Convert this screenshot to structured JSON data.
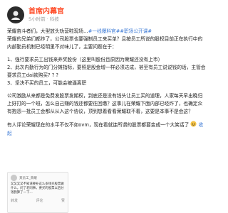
{
  "header": {
    "username": "首席内幕官",
    "sublabel": "5小时前 · 科技"
  },
  "post": {
    "intro": "荣耀奋斗者们，大型放头劝营啦现场…",
    "tag1": "#一线爆料官#",
    "tag2": "#职场公开课#",
    "sentences": [
      "荣耀的兄弟们都炸了，公司股票也要强制员工来买单？且按员工所说的股权目前正在执行中的内部勤员机制已经明里不对味儿了，主要问题在于：",
      "1、强行要求员工出钱来养奖股份（这里叫股份且原因为荣耀还没有上市）",
      "2、此次内勤行为的门分摊指标，要照是股金增一样必须达成，甚至有员工说说钱的话，主管会要求员工dai款购买? ? ?",
      "3、坚决不买的员工，可能会被逼离职",
      "公司激励从来都是免费发股票发期权，到底还是没有钱头让员工买的道理，人家每天早出晚归上好打的一个班，怎么自己赚的钱还都要往回缴？这事儿在荣耀下面内部已经炸了，也确定众有抱怨一批员工会都从从入这个协议，顶到想着看看荣耀取不着，这要是本事不是会这？",
      "有人评论荣耀现在的水平不仅不如ovm，现在看就连所谓的股票都要变成一个大笑话了"
    ],
    "end_text": "收起"
  },
  "embedded_screenshot": {
    "user_label": "某员工_荣耀",
    "text": "又又又又不知道要补这么多钱买股票做什么，问了老同事，要买的股票以后分钱我算了一下…",
    "actions": [
      "转发",
      "评论",
      "赞"
    ]
  },
  "colors": {
    "username": "#ff4e2a",
    "link": "#3e7bd6",
    "text": "#222222"
  }
}
